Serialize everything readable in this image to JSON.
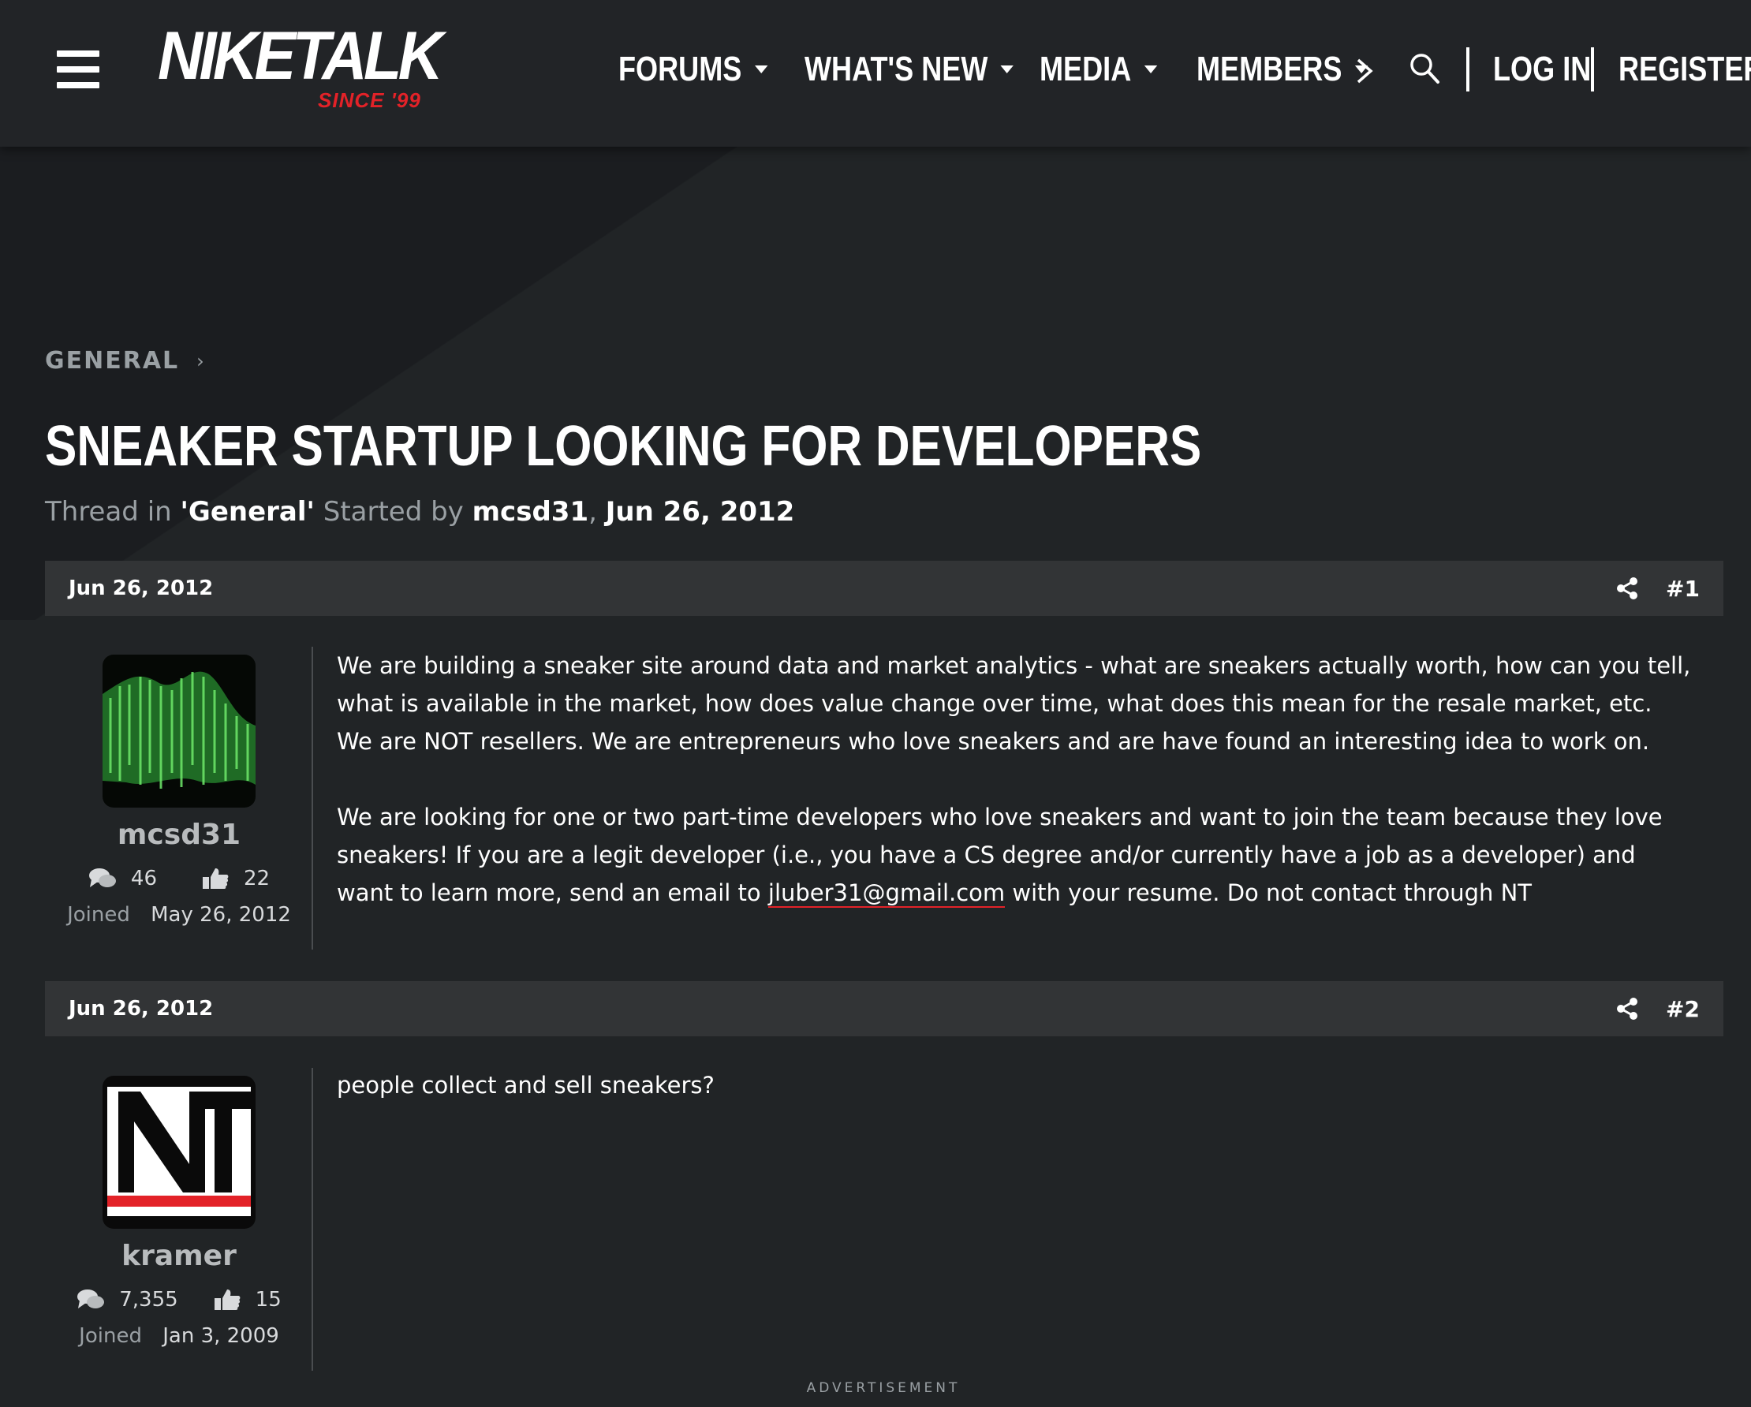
{
  "header": {
    "logo_text": "NIKETALK",
    "logo_sub": "SINCE '99",
    "nav": [
      "FORUMS",
      "WHAT'S NEW",
      "MEDIA",
      "MEMBERS"
    ],
    "login": "LOG IN",
    "register": "REGISTER"
  },
  "breadcrumb": {
    "label": "GENERAL",
    "separator": "›"
  },
  "thread": {
    "title": "SNEAKER STARTUP LOOKING FOR DEVELOPERS",
    "meta_prefix": "Thread in",
    "forum": "'General'",
    "meta_started": "Started by",
    "author": "mcsd31",
    "comma": ",",
    "date": "Jun 26, 2012"
  },
  "posts": [
    {
      "date": "Jun 26, 2012",
      "number": "#1",
      "username": "mcsd31",
      "messages": "46",
      "likes": "22",
      "joined_label": "Joined",
      "joined_date": "May 26, 2012",
      "paragraph1": "We are building a sneaker site around data and market analytics - what are sneakers actually worth, how can you tell, what is available in the market, how does value change over time, what does this mean for the resale market, etc.  We are NOT resellers.  We are entrepreneurs who love sneakers and are have found an interesting idea to work on.",
      "paragraph2_pre": "We are looking for one or two part-time developers who love sneakers and want to join the team because they love sneakers!  If you are a legit developer (i.e., you have a CS degree and/or currently have a job as a developer) and want to learn more, send an email to ",
      "email": "jluber31@gmail.com",
      "paragraph2_post": " with your resume.  Do not contact through NT"
    },
    {
      "date": "Jun 26, 2012",
      "number": "#2",
      "username": "kramer",
      "messages": "7,355",
      "likes": "15",
      "joined_label": "Joined",
      "joined_date": "Jan 3, 2009",
      "body": "people collect and sell sneakers?"
    }
  ],
  "advertisement": "ADVERTISEMENT",
  "colors": {
    "accent": "#e32228",
    "bar": "#323436",
    "background": "#212426"
  }
}
